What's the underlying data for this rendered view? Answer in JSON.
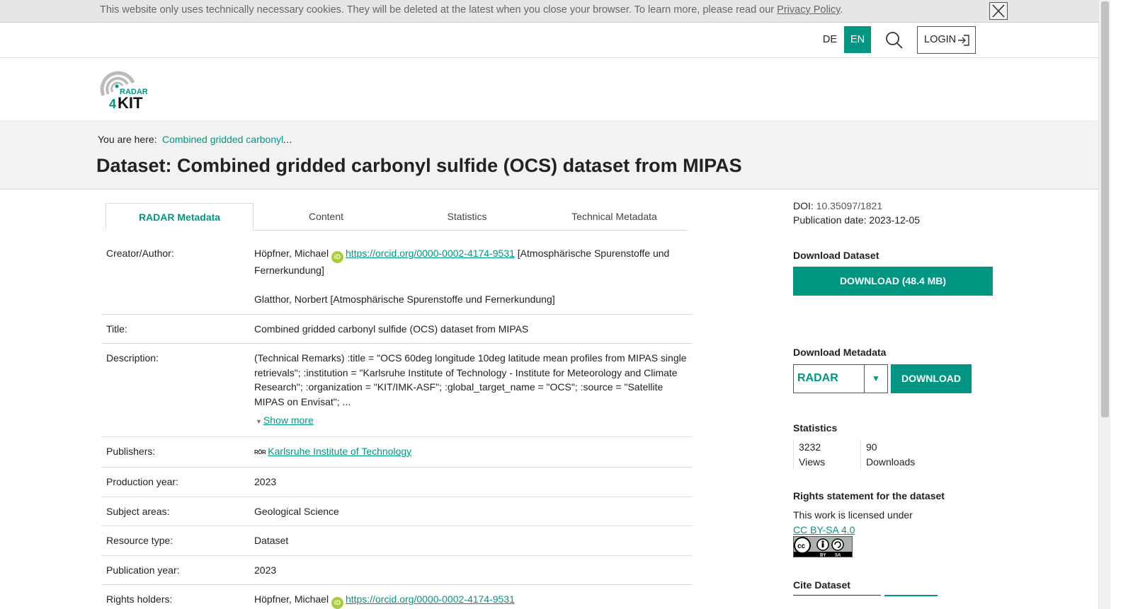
{
  "cookie_banner": {
    "message": "This website only uses technically necessary cookies. They will be deleted at the latest when you close your browser. To learn more, please read our ",
    "link": "Privacy Policy",
    "end": "."
  },
  "topnav": {
    "lang_de": "DE",
    "lang_en": "EN",
    "login": "LOGIN"
  },
  "logo": {
    "word1": "RADAR",
    "word2": "4",
    "word3": "KIT"
  },
  "breadcrumb": {
    "label": "You are here:",
    "item": "Combined gridded carbonyl",
    "ellipsis": "…"
  },
  "page_title": "Dataset: Combined gridded carbonyl sulfide (OCS) dataset from MIPAS",
  "tabs": [
    "RADAR Metadata",
    "Content",
    "Statistics",
    "Technical Metadata"
  ],
  "metadata": {
    "creator_label": "Creator/Author:",
    "creator1_name": "Höpfner, Michael",
    "creator1_orcid": "https://orcid.org/0000-0002-4174-9531",
    "creator1_affil": "[Atmosphärische Spurenstoffe und Fernerkundung]",
    "creator2": "Glatthor, Norbert [Atmosphärische Spurenstoffe und Fernerkundung]",
    "title_label": "Title:",
    "title_value": "Combined gridded carbonyl sulfide (OCS) dataset from MIPAS",
    "description_label": "Description:",
    "description_value": "(Technical Remarks) :title = \"OCS 60deg longitude 10deg latitude mean profiles from MIPAS single retrievals\"; :institution = \"Karlsruhe Institute of Technology - Institute for Meteorology and Climate Research\"; :organization = \"KIT/IMK-ASF\"; :global_target_name = \"OCS\"; :source = \"Satellite MIPAS on Envisat\"; ...",
    "show_more": "Show more",
    "publishers_label": "Publishers:",
    "publishers_badge": "RŌR",
    "publishers_value": "Karlsruhe Institute of Technology",
    "production_year_label": "Production year:",
    "production_year_value": "2023",
    "subject_label": "Subject areas:",
    "subject_value": "Geological Science",
    "resource_label": "Resource type:",
    "resource_value": "Dataset",
    "publication_year_label": "Publication year:",
    "publication_year_value": "2023",
    "rights_label": "Rights holders:",
    "rights_name": "Höpfner, Michael",
    "rights_orcid": "https://orcid.org/0000-0002-4174-9531"
  },
  "sidebar": {
    "doi_label": "DOI:",
    "doi_value": "10.35097/1821",
    "pubdate_label": "Publication date:",
    "pubdate_value": "2023-12-05",
    "download_dataset_heading": "Download Dataset",
    "download_dataset_button": "DOWNLOAD (48.4 MB)",
    "download_metadata_heading": "Download Metadata",
    "metadata_format": "RADAR",
    "download_metadata_button": "DOWNLOAD",
    "statistics_heading": "Statistics",
    "views_count": "3232",
    "views_label": "Views",
    "downloads_count": "90",
    "downloads_label": "Downloads",
    "rights_heading": "Rights statement for the dataset",
    "rights_text": "This work is licensed under",
    "license_link": "CC BY-SA 4.0",
    "cite_heading": "Cite Dataset"
  },
  "colors": {
    "accent": "#009682",
    "orcid": "#a6ce39"
  }
}
